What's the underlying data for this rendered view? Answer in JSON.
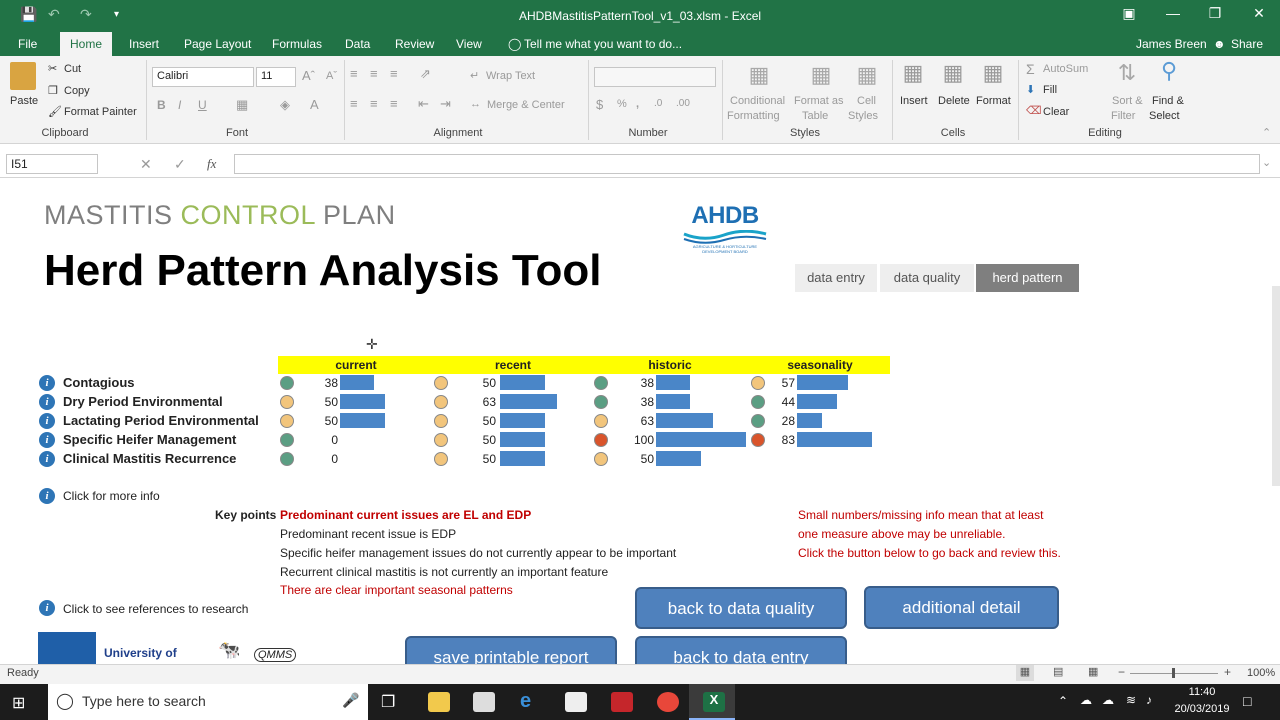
{
  "window": {
    "title": "AHDBMastitisPatternTool_v1_03.xlsm - Excel"
  },
  "ribbon_tabs": [
    "File",
    "Home",
    "Insert",
    "Page Layout",
    "Formulas",
    "Data",
    "Review",
    "View"
  ],
  "tell_me": "Tell me what you want to do...",
  "user": "James Breen",
  "share": "Share",
  "clipboard": {
    "paste": "Paste",
    "cut": "Cut",
    "copy": "Copy",
    "format_painter": "Format Painter",
    "group": "Clipboard"
  },
  "font": {
    "name": "Calibri",
    "size": "11",
    "group": "Font"
  },
  "alignment": {
    "wrap": "Wrap Text",
    "merge": "Merge & Center",
    "group": "Alignment"
  },
  "number": {
    "group": "Number"
  },
  "styles": {
    "cond1": "Conditional",
    "cond2": "Formatting",
    "fmt1": "Format as",
    "fmt2": "Table",
    "cell1": "Cell",
    "cell2": "Styles",
    "group": "Styles"
  },
  "cells": {
    "insert": "Insert",
    "delete": "Delete",
    "format": "Format",
    "group": "Cells"
  },
  "editing": {
    "autosum": "AutoSum",
    "fill": "Fill",
    "clear": "Clear",
    "sort1": "Sort &",
    "sort2": "Filter",
    "find1": "Find &",
    "find2": "Select",
    "group": "Editing"
  },
  "formula_bar": {
    "name_box": "I51",
    "fx": "fx"
  },
  "sheet": {
    "subtitle_parts": [
      "MASTITIS ",
      "CONTROL",
      " PLAN"
    ],
    "title": "Herd Pattern Analysis Tool",
    "logo": "AHDB",
    "logo_sub": "AGRICULTURE & HORTICULTURE DEVELOPMENT BOARD",
    "nav": [
      "data entry",
      "data quality",
      "herd pattern"
    ],
    "columns": [
      "current",
      "recent",
      "historic",
      "seasonality"
    ],
    "rows": [
      {
        "label": "Contagious",
        "cells": [
          {
            "status": "green",
            "value": "38",
            "fraction": 0.38
          },
          {
            "status": "amber",
            "value": "50",
            "fraction": 0.5
          },
          {
            "status": "green",
            "value": "38",
            "fraction": 0.38
          },
          {
            "status": "amber",
            "value": "57",
            "fraction": 0.57
          }
        ]
      },
      {
        "label": "Dry Period Environmental",
        "cells": [
          {
            "status": "amber",
            "value": "50",
            "fraction": 0.5
          },
          {
            "status": "amber",
            "value": "63",
            "fraction": 0.63
          },
          {
            "status": "green",
            "value": "38",
            "fraction": 0.38
          },
          {
            "status": "green",
            "value": "44",
            "fraction": 0.44
          }
        ]
      },
      {
        "label": "Lactating Period Environmental",
        "cells": [
          {
            "status": "amber",
            "value": "50",
            "fraction": 0.5
          },
          {
            "status": "amber",
            "value": "50",
            "fraction": 0.5
          },
          {
            "status": "amber",
            "value": "63",
            "fraction": 0.63
          },
          {
            "status": "green",
            "value": "28",
            "fraction": 0.28
          }
        ]
      },
      {
        "label": "Specific Heifer Management",
        "cells": [
          {
            "status": "green",
            "value": "0",
            "fraction": 0
          },
          {
            "status": "amber",
            "value": "50",
            "fraction": 0.5
          },
          {
            "status": "red",
            "value": "100",
            "fraction": 1.0
          },
          {
            "status": "red",
            "value": "83",
            "fraction": 0.83
          }
        ]
      },
      {
        "label": "Clinical Mastitis Recurrence",
        "cells": [
          {
            "status": "green",
            "value": "0",
            "fraction": 0
          },
          {
            "status": "amber",
            "value": "50",
            "fraction": 0.5
          },
          {
            "status": "amber",
            "value": "50",
            "fraction": 0.5
          },
          {
            "status": "none",
            "value": "",
            "fraction": 0
          }
        ]
      }
    ],
    "status_colors": {
      "green": "#5b9e83",
      "amber": "#f2c57c",
      "red": "#d9542b",
      "bar": "#4a86c8"
    },
    "more_info": "Click for more info",
    "key_points_label": "Key points",
    "key_points": [
      {
        "text": "Predominant current issues are EL and EDP",
        "style": "red-bold"
      },
      {
        "text": "Predominant recent issue is EDP",
        "style": "normal"
      },
      {
        "text": "Specific heifer management issues do not currently appear to be important",
        "style": "normal"
      },
      {
        "text": "Recurrent clinical mastitis is not currently an important feature",
        "style": "normal"
      },
      {
        "text": "There are clear important seasonal patterns",
        "style": "red"
      }
    ],
    "warning": [
      "Small numbers/missing info mean that at least",
      "one measure above may be unreliable.",
      "Click the button below to go back and review this."
    ],
    "references": "Click to see references to research",
    "buttons": {
      "back_quality": "back to data quality",
      "additional": "additional detail",
      "save_report": "save printable report",
      "back_entry": "back to data entry"
    },
    "uni_logo": "University of",
    "qmms_logo": "QMMS"
  },
  "statusbar": {
    "ready": "Ready",
    "zoom": "100%"
  },
  "taskbar": {
    "search": "Type here to search",
    "time": "11:40",
    "date": "20/03/2019"
  }
}
